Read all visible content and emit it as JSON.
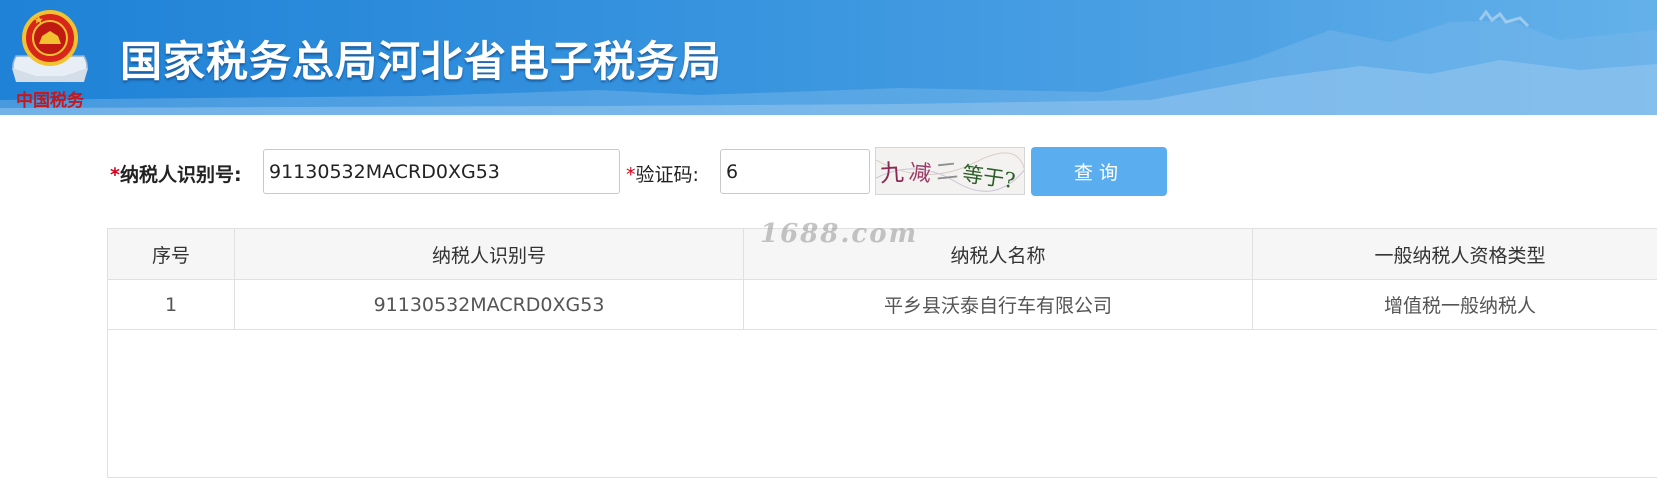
{
  "header": {
    "title": "国家税务总局河北省电子税务局",
    "emblem_caption": "中国税务",
    "banner_color": "#3592de"
  },
  "form": {
    "taxid_required_mark": "*",
    "taxid_label": "纳税人识别号:",
    "taxid_value": "91130532MACRD0XG53",
    "captcha_required_mark": "*",
    "captcha_label": "验证码:",
    "captcha_value": "6",
    "captcha_image_text": [
      "九",
      "减",
      "二",
      "等于?"
    ],
    "query_button": "查询",
    "button_color": "#5aaeef"
  },
  "watermark": "1688.com",
  "table": {
    "columns": [
      "序号",
      "纳税人识别号",
      "纳税人名称",
      "一般纳税人资格类型"
    ],
    "rows": [
      [
        "1",
        "91130532MACRD0XG53",
        "平乡县沃泰自行车有限公司",
        "增值税一般纳税人"
      ]
    ]
  }
}
